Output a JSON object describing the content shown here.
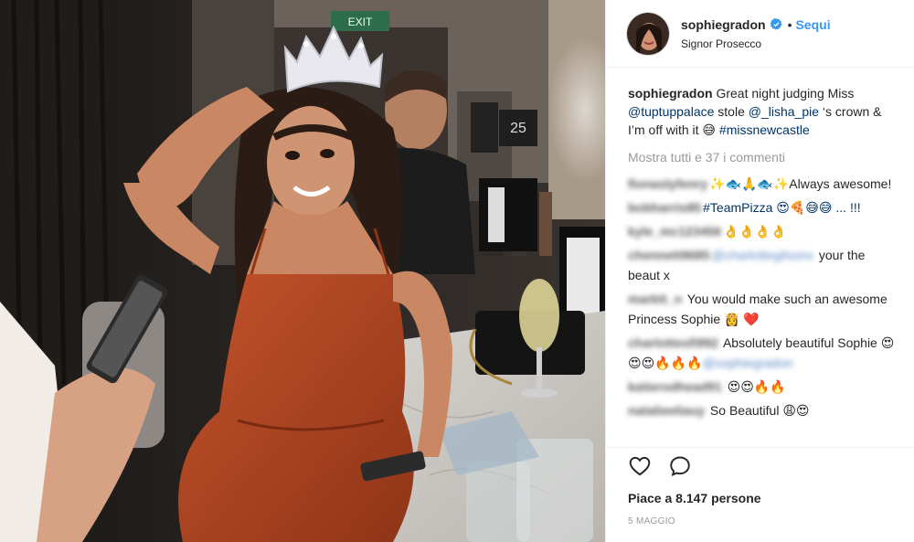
{
  "colors": {
    "accent": "#3897f0",
    "link": "#003569",
    "muted": "#999999",
    "verified": "#3897f0"
  },
  "post": {
    "exit_sign": "EXIT",
    "wall_number": "25",
    "header": {
      "username": "sophiegradon",
      "follow_separator": "•",
      "follow_label": "Sequi",
      "location": "Signor Prosecco"
    },
    "caption": {
      "username": "sophiegradon",
      "text_1": " Great night judging Miss ",
      "mention_1": "@tuptuppalace",
      "text_2": " stole ",
      "mention_2": "@_lisha_pie",
      "text_3": " ‘s crown & I’m off with it 😅 ",
      "hashtag": "#missnewcastle"
    },
    "view_all": "Mostra tutti e 37 i commenti",
    "comments": [
      {
        "user": "fionaslyfenry",
        "mention": "",
        "text": "✨🐟🙏🐟✨Always awesome!"
      },
      {
        "user": "bobharris85",
        "mention": "",
        "text": "#TeamPizza 😍🍕😅😅 ... !!!"
      },
      {
        "user": "kyle_mc123456",
        "mention": "",
        "text": "👌👌👌👌"
      },
      {
        "user": "chennett9685",
        "mention": "@charlottegilsonx",
        "text": " your the beaut x"
      },
      {
        "user": "marktt_n",
        "mention": "",
        "text": " You would make such an awesome Princess Sophie 👸 ❤️"
      },
      {
        "user": "charlottesfi992",
        "mention": "@sophiegradon",
        "text": " Absolutely beautiful Sophie 😍😍😍🔥🔥🔥"
      },
      {
        "user": "katierodhead91",
        "mention": "",
        "text": " 😍😍🔥🔥"
      },
      {
        "user": "natalieeliauy",
        "mention": "",
        "text": " So Beautiful 😩😍"
      }
    ],
    "likes_label": "Piace a 8.147 persone",
    "date": "5 MAGGIO",
    "icons": {
      "like": "heart-outline-icon",
      "comment": "speech-bubble-icon",
      "verified": "verified-badge-icon"
    }
  }
}
